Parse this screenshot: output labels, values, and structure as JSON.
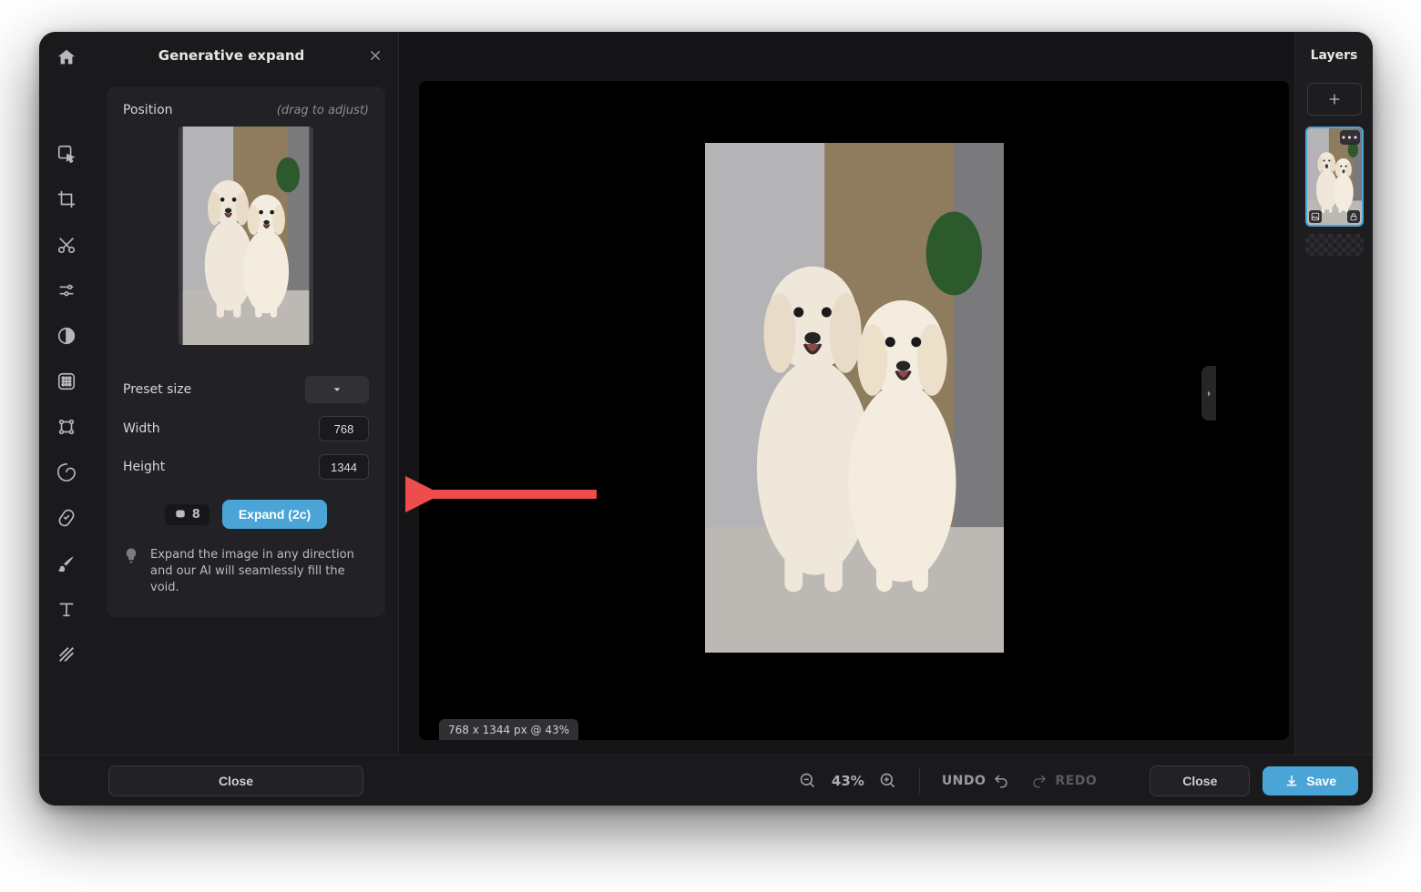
{
  "panel": {
    "title": "Generative expand",
    "position_label": "Position",
    "position_hint": "(drag to adjust)",
    "preset_label": "Preset size",
    "width_label": "Width",
    "width_value": "768",
    "height_label": "Height",
    "height_value": "1344",
    "credits_count": "8",
    "expand_button": "Expand (2c)",
    "tip_text": "Expand the image in any direction and our AI will seamlessly fill the void."
  },
  "canvas": {
    "dimensions_badge": "768 x 1344 px @ 43%"
  },
  "layers_panel": {
    "title": "Layers"
  },
  "footer": {
    "close_left": "Close",
    "zoom_percent": "43%",
    "undo_label": "UNDO",
    "redo_label": "REDO",
    "close_right": "Close",
    "save_label": "Save"
  }
}
